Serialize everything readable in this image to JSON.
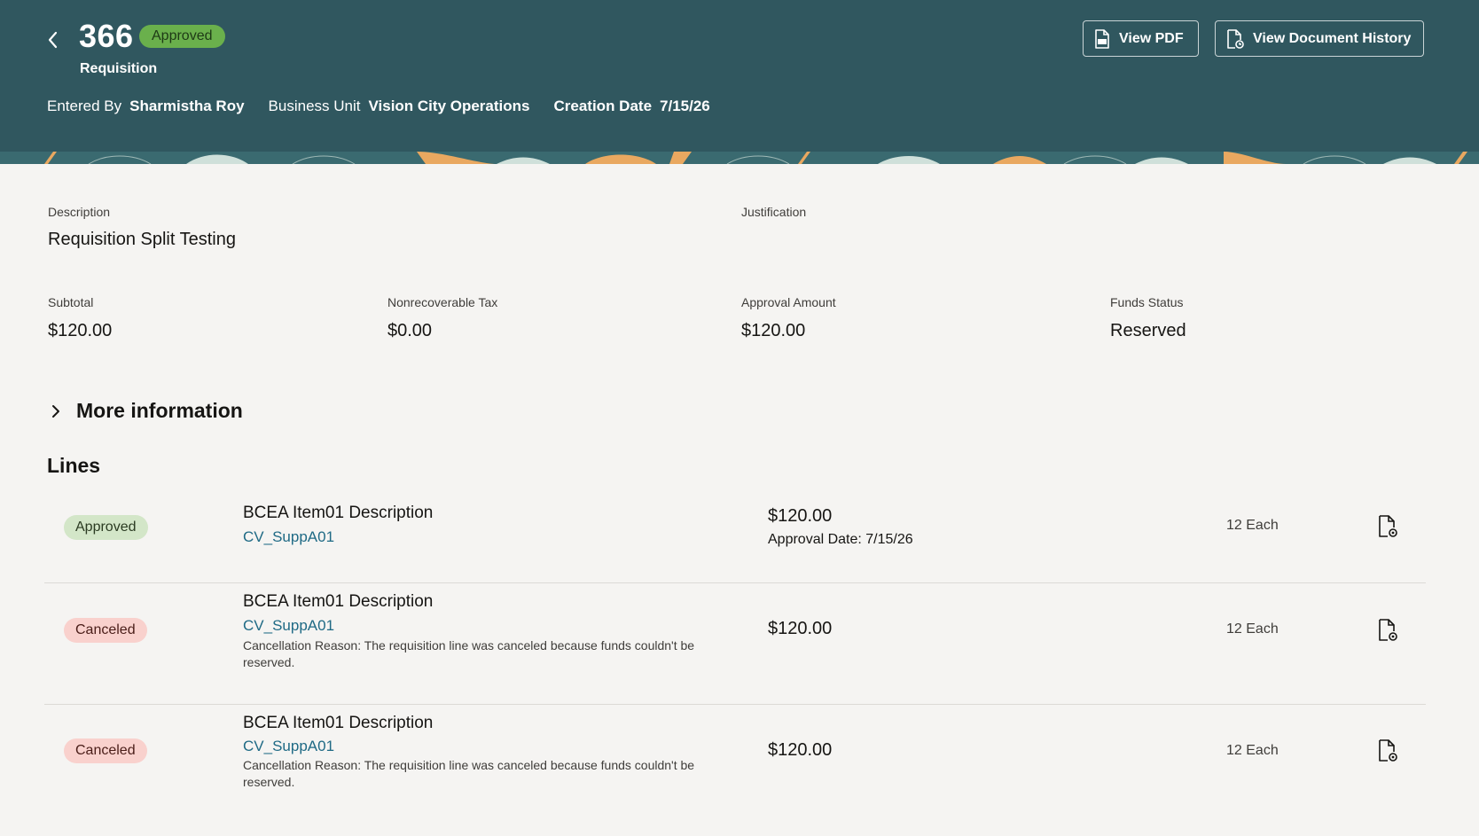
{
  "header": {
    "req_number": "366",
    "status_badge": "Approved",
    "doc_type": "Requisition",
    "entered_by_label": "Entered By",
    "entered_by": "Sharmistha Roy",
    "bu_label": "Business Unit",
    "bu": "Vision City Operations",
    "creation_label": "Creation Date",
    "creation_date": "7/15/26",
    "view_pdf_label": "View PDF",
    "view_history_label": "View Document History",
    "bg_color": "#30575f"
  },
  "details": {
    "description_label": "Description",
    "description": "Requisition Split Testing",
    "justification_label": "Justification",
    "subtotal_label": "Subtotal",
    "subtotal": "$120.00",
    "tax_label": "Nonrecoverable Tax",
    "tax": "$0.00",
    "approval_label": "Approval Amount",
    "approval": "$120.00",
    "funds_label": "Funds Status",
    "funds": "Reserved"
  },
  "more_info_label": "More information",
  "lines_title": "Lines",
  "lines": [
    {
      "status": "Approved",
      "title": "BCEA Item01 Description",
      "supplier": "CV_SuppA01",
      "amount": "$120.00",
      "approval_date": "Approval Date: 7/15/26",
      "qty": "12 Each"
    },
    {
      "status": "Canceled",
      "title": "BCEA Item01 Description",
      "supplier": "CV_SuppA01",
      "reason_line1": "Cancellation Reason: The requisition line was canceled because funds couldn't be",
      "reason_line2": "reserved.",
      "amount": "$120.00",
      "qty": "12 Each"
    },
    {
      "status": "Canceled",
      "title": "BCEA Item01 Description",
      "supplier": "CV_SuppA01",
      "reason_line1": "Cancellation Reason: The requisition line was canceled because funds couldn't be",
      "reason_line2": "reserved.",
      "amount": "$120.00",
      "qty": "12 Each"
    }
  ]
}
